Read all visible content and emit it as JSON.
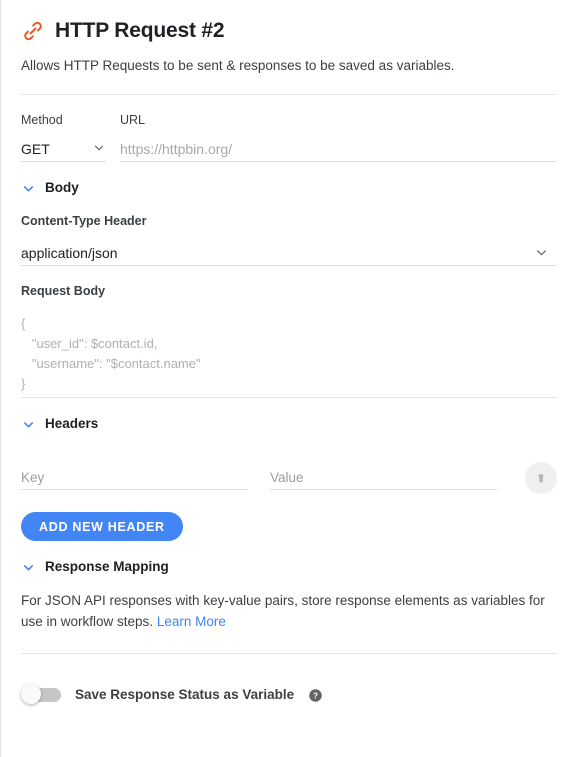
{
  "header": {
    "icon": "link-chain-icon",
    "icon_color": "#e8571f",
    "title": "HTTP Request #2",
    "description": "Allows HTTP Requests to be sent & responses to be saved as variables."
  },
  "request": {
    "method_label": "Method",
    "method_value": "GET",
    "url_label": "URL",
    "url_value": "",
    "url_placeholder": "https://httpbin.org/"
  },
  "body_section": {
    "title": "Body",
    "chevron": "chevron-down-icon",
    "content_type_label": "Content-Type Header",
    "content_type_value": "application/json",
    "request_body_label": "Request Body",
    "request_body_value": "",
    "request_body_placeholder": "{\n   \"user_id\": $contact.id,\n   \"username\": \"$contact.name\"\n}"
  },
  "headers_section": {
    "title": "Headers",
    "chevron": "chevron-down-icon",
    "key_placeholder": "Key",
    "key_value": "",
    "value_placeholder": "Value",
    "value_value": "",
    "delete_icon": "trash-icon",
    "add_button_label": "ADD NEW HEADER"
  },
  "response_mapping": {
    "title": "Response Mapping",
    "chevron": "chevron-down-icon",
    "description": "For JSON API responses with key-value pairs, store response elements as variables for use in workflow steps. ",
    "link_label": "Learn More"
  },
  "footer": {
    "toggle_label": "Save Response Status as Variable",
    "toggle_state": "off",
    "help_icon": "help-circle-icon"
  },
  "colors": {
    "accent_blue": "#4285f4",
    "icon_orange": "#e8571f",
    "text_primary": "#202124",
    "placeholder_grey": "#a8a8a8"
  }
}
